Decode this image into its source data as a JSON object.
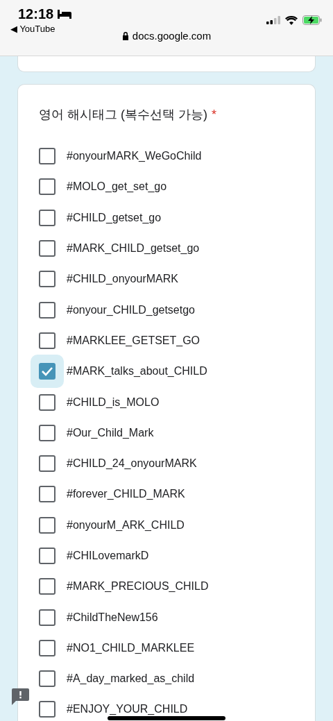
{
  "status_bar": {
    "time": "12:18",
    "back_app": "◀ YouTube",
    "url": "docs.google.com"
  },
  "question": {
    "title": "영어 해시태그 (복수선택 가능)",
    "required_mark": "*",
    "options": [
      {
        "label": "#onyourMARK_WeGoChild",
        "checked": false
      },
      {
        "label": "#MOLO_get_set_go",
        "checked": false
      },
      {
        "label": "#CHILD_getset_go",
        "checked": false
      },
      {
        "label": "#MARK_CHILD_getset_go",
        "checked": false
      },
      {
        "label": "#CHILD_onyourMARK",
        "checked": false
      },
      {
        "label": "#onyour_CHILD_getsetgo",
        "checked": false
      },
      {
        "label": "#MARKLEE_GETSET_GO",
        "checked": false
      },
      {
        "label": "#MARK_talks_about_CHILD",
        "checked": true
      },
      {
        "label": "#CHILD_is_MOLO",
        "checked": false
      },
      {
        "label": "#Our_Child_Mark",
        "checked": false
      },
      {
        "label": "#CHILD_24_onyourMARK",
        "checked": false
      },
      {
        "label": "#forever_CHILD_MARK",
        "checked": false
      },
      {
        "label": "#onyourM_ARK_CHILD",
        "checked": false
      },
      {
        "label": "#CHILovemarkD",
        "checked": false
      },
      {
        "label": "#MARK_PRECIOUS_CHILD",
        "checked": false
      },
      {
        "label": "#ChildTheNew156",
        "checked": false
      },
      {
        "label": "#NO1_CHILD_MARKLEE",
        "checked": false
      },
      {
        "label": "#A_day_marked_as_child",
        "checked": false
      },
      {
        "label": "#ENJOY_YOUR_CHILD",
        "checked": false
      }
    ]
  }
}
